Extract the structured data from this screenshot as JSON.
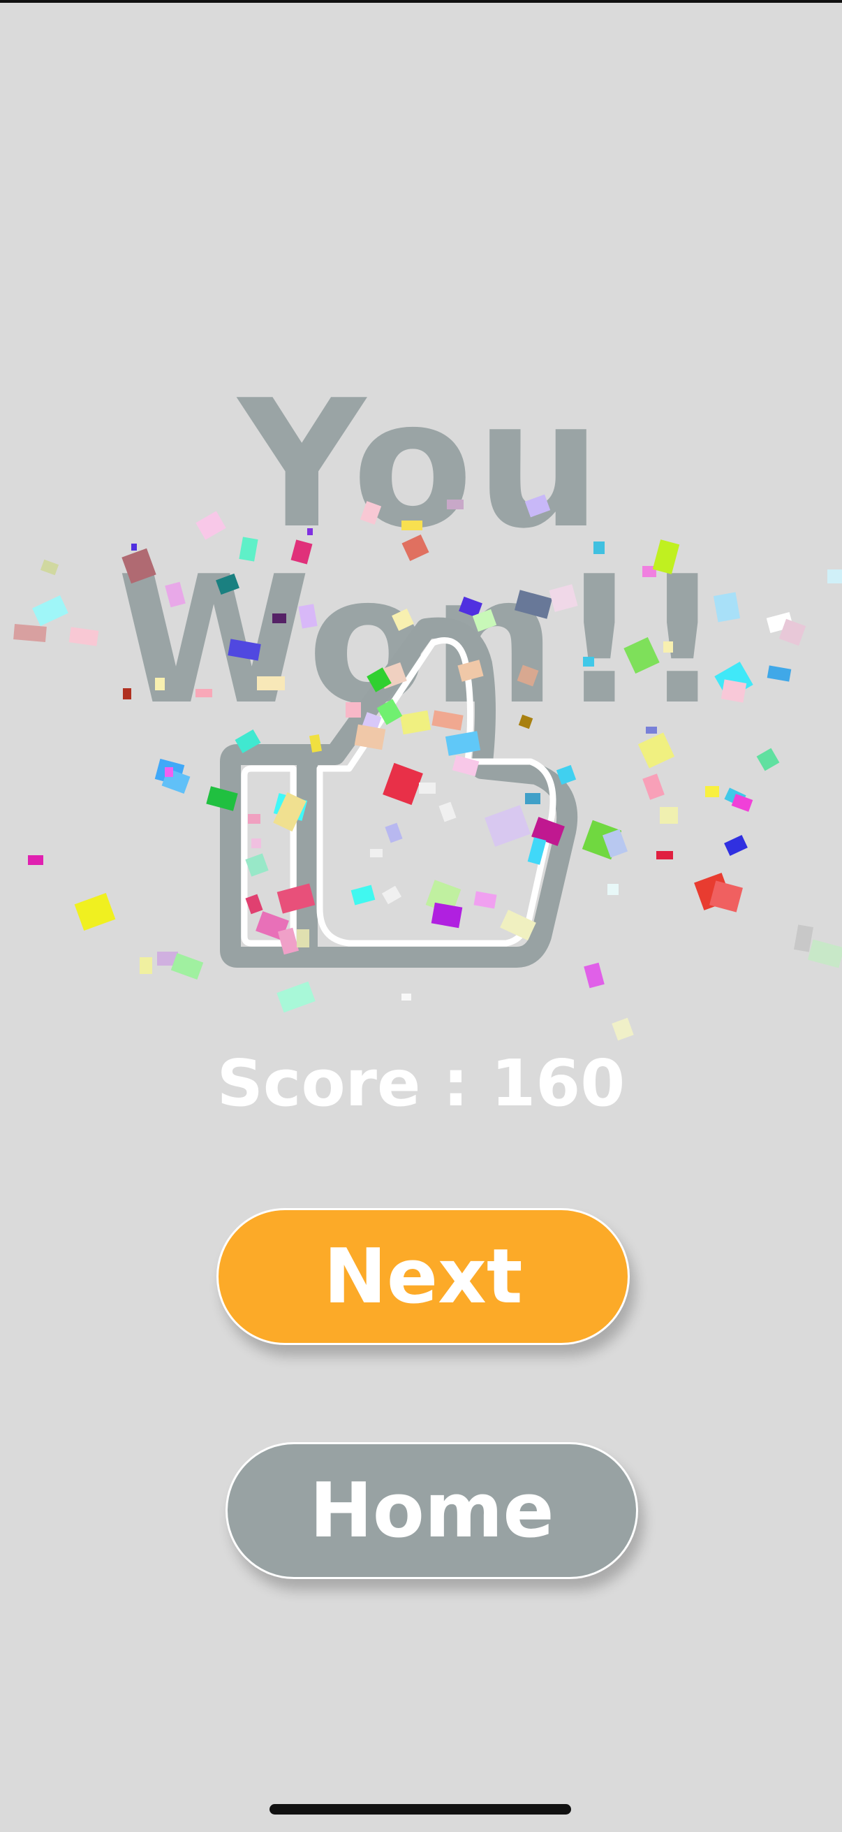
{
  "screen": {
    "title": "You Won!!",
    "score_text": "Score : 160",
    "next_label": "Next",
    "home_label": "Home"
  },
  "colors": {
    "background": "#dadada",
    "title": "#9aa4a5",
    "next_button": "#fcaa28",
    "home_button": "#98a2a3",
    "text_white": "#ffffff"
  },
  "icons": {
    "main": "thumbs-up-icon",
    "effect": "confetti"
  }
}
